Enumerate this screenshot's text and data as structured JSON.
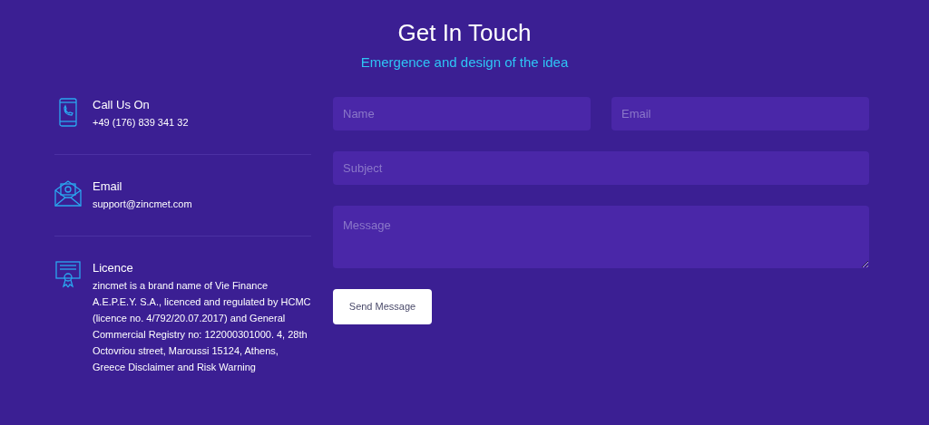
{
  "title": "Get In Touch",
  "subtitle": "Emergence and design of the idea",
  "contacts": [
    {
      "kind": "phone",
      "label": "Call Us On",
      "value": "+49 (176) 839 341 32"
    },
    {
      "kind": "email",
      "label": "Email",
      "value": "support@zincmet.com"
    },
    {
      "kind": "licence",
      "label": "Licence",
      "value": "zincmet is a brand name of Vie Finance A.E.P.E.Y. S.A., licenced and regulated by HCMC (licence no. 4/792/20.07.2017) and General Commercial Registry no: 122000301000. 4, 28th Octovriou street, Maroussi 15124, Athens, Greece Disclaimer and Risk Warning"
    }
  ],
  "form": {
    "name": {
      "placeholder": "Name"
    },
    "email": {
      "placeholder": "Email"
    },
    "subject": {
      "placeholder": "Subject"
    },
    "message": {
      "placeholder": "Message"
    },
    "button": "Send Message"
  }
}
